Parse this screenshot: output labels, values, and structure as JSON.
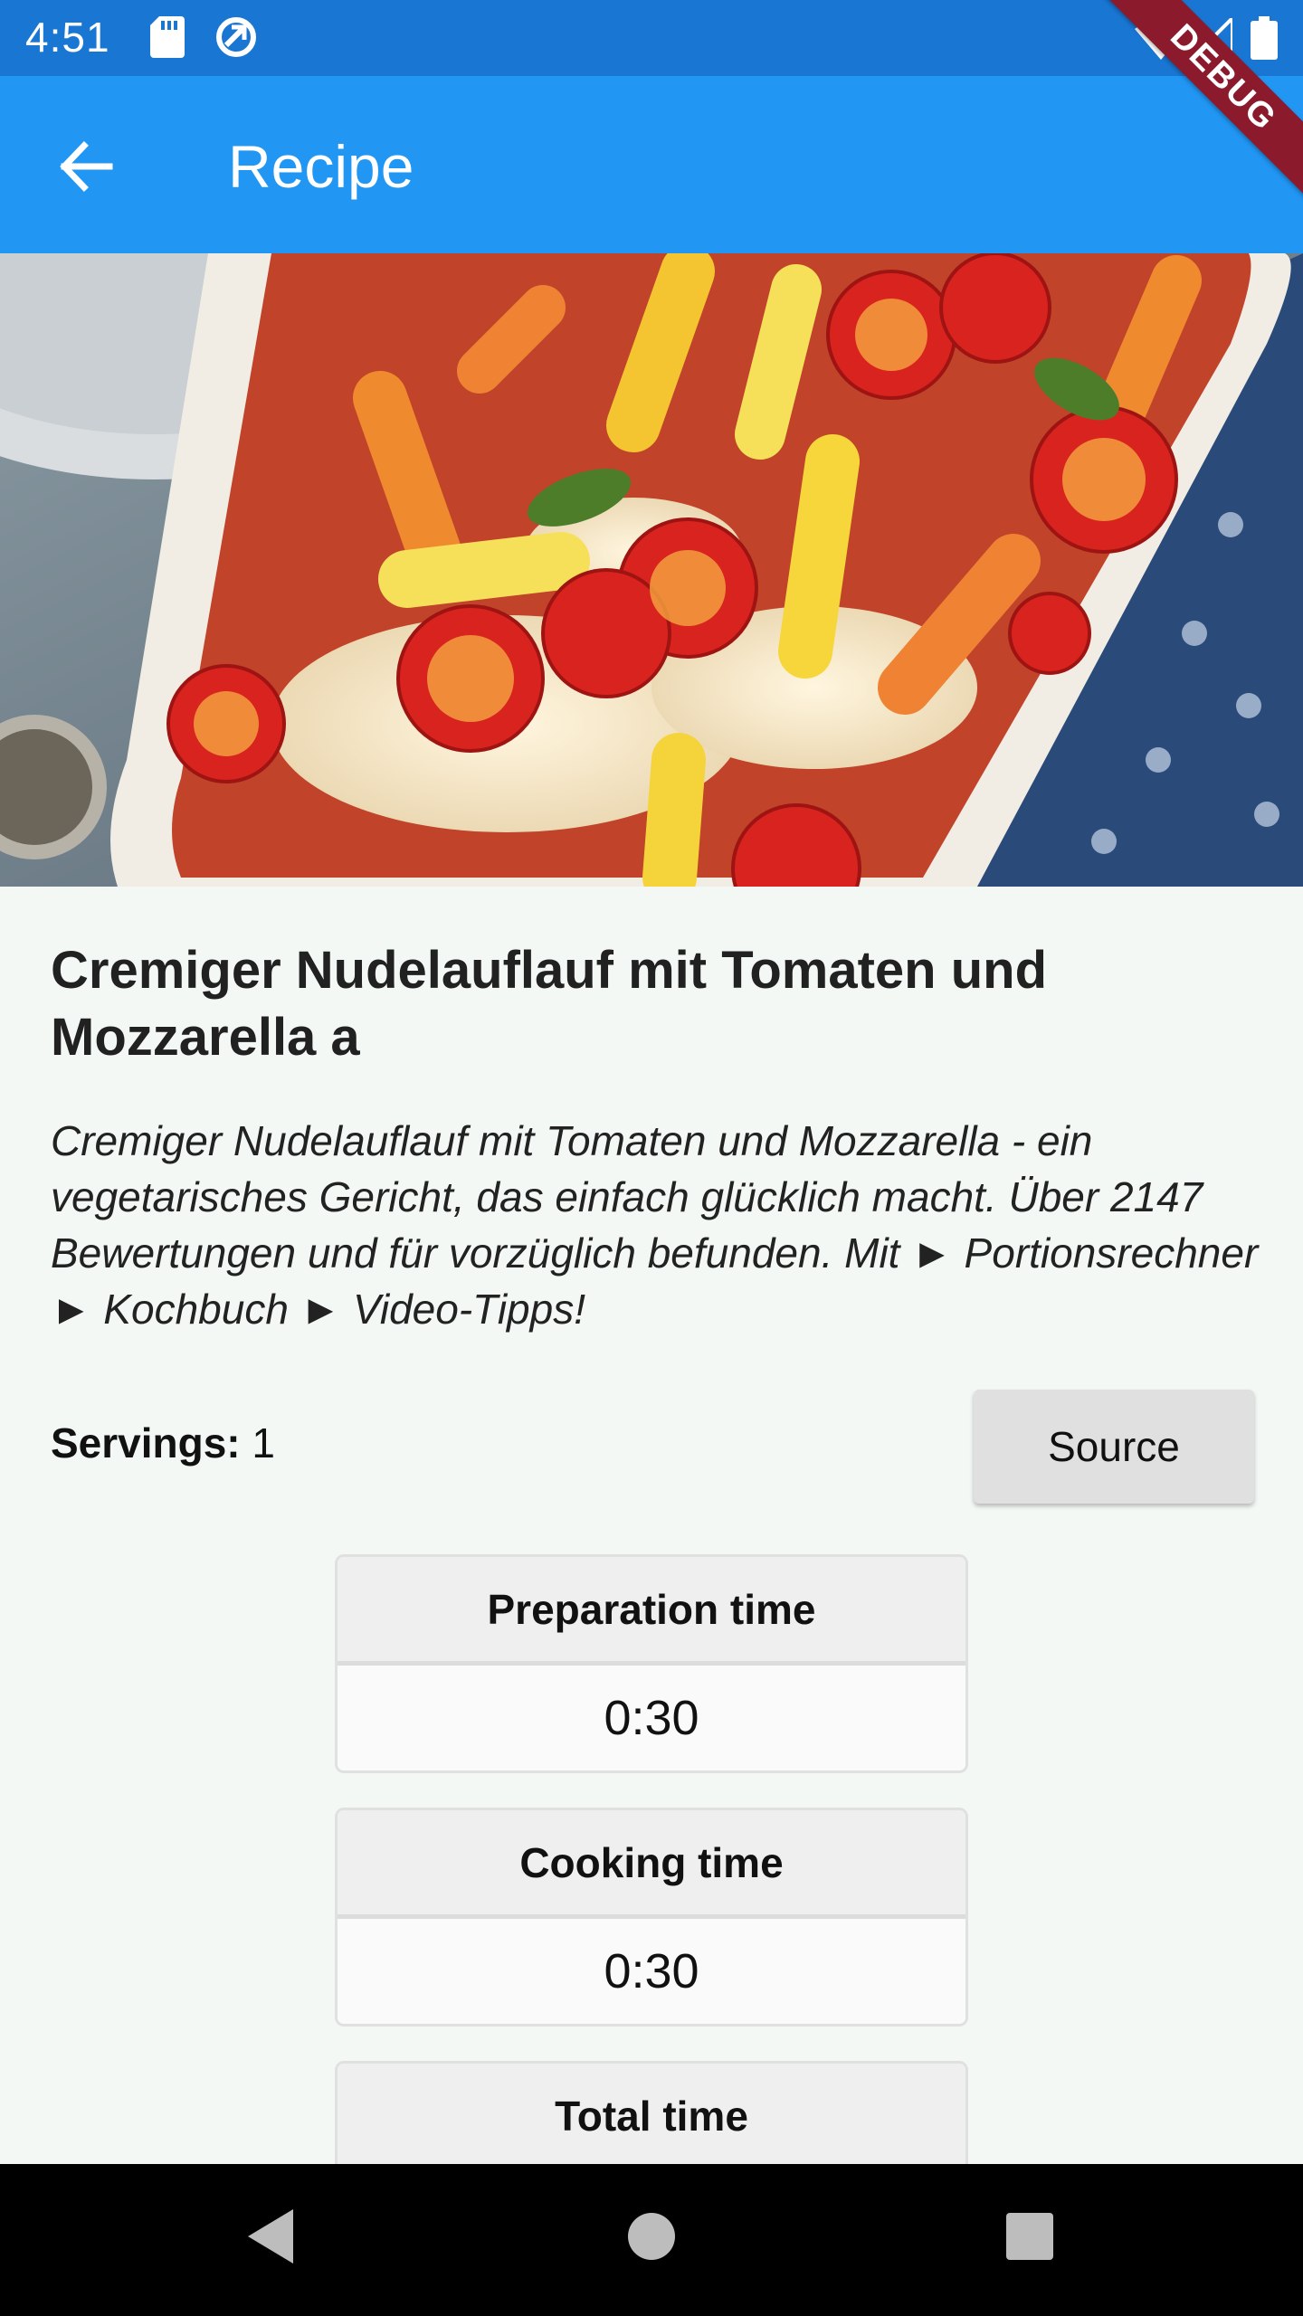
{
  "status_bar": {
    "time": "4:51",
    "debug_label": "DEBUG"
  },
  "app_bar": {
    "title": "Recipe"
  },
  "recipe": {
    "title": "Cremiger Nudelauflauf mit Tomaten und Mozzarella a",
    "description": "Cremiger Nudelauflauf mit Tomaten und Mozzarella - ein vegetarisches Gericht, das einfach glücklich macht. Über 2147 Bewertungen und für vorzüglich befunden. Mit ► Portionsrechner ► Kochbuch ► Video-Tipps!",
    "servings_label": "Servings:",
    "servings_value": "1",
    "source_button": "Source",
    "times": {
      "preparation": {
        "label": "Preparation time",
        "value": "0:30"
      },
      "cooking": {
        "label": "Cooking time",
        "value": "0:30"
      },
      "total": {
        "label": "Total time"
      }
    }
  },
  "colors": {
    "status_bar": "#1976d2",
    "app_bar": "#2196f3",
    "debug_banner": "#8b1a2c",
    "background": "#f4f8f5"
  },
  "icons": [
    "sd-card-icon",
    "sync-icon",
    "wifi-icon",
    "signal-icon",
    "battery-icon",
    "back-arrow-icon",
    "nav-back-icon",
    "nav-home-icon",
    "nav-recents-icon"
  ]
}
